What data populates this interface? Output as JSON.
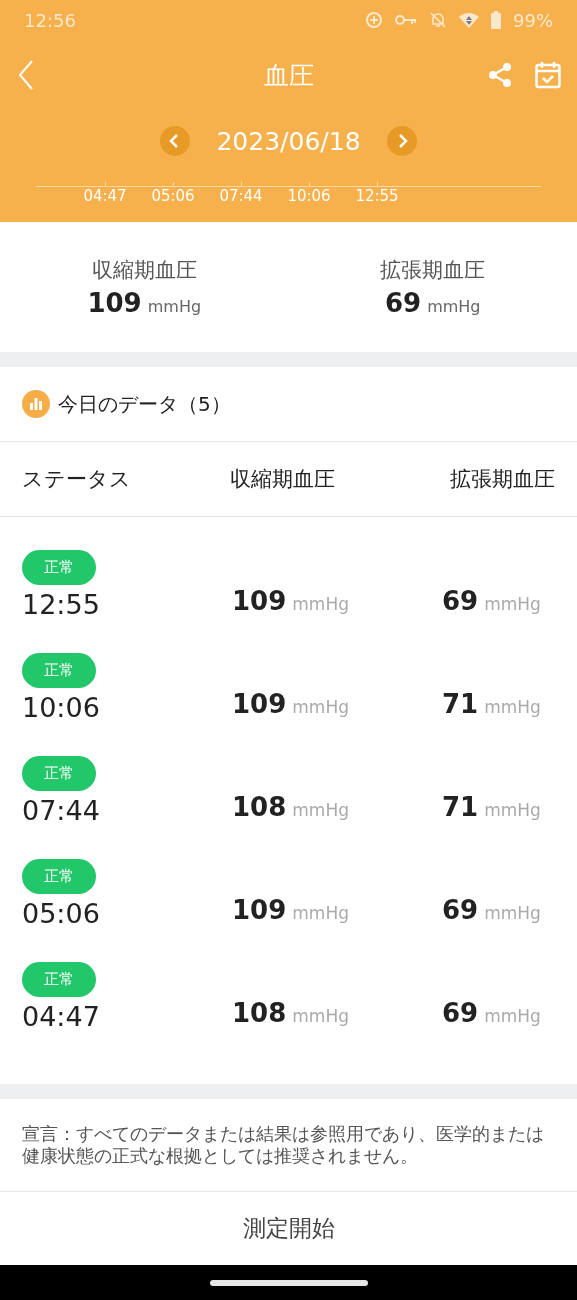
{
  "status_bar": {
    "time": "12:56",
    "battery": "99%"
  },
  "header": {
    "title": "血圧",
    "date": "2023/06/18",
    "timeline": [
      "04:47",
      "05:06",
      "07:44",
      "10:06",
      "12:55"
    ]
  },
  "summary": [
    {
      "label": "収縮期血圧",
      "value": "109",
      "unit": "mmHg"
    },
    {
      "label": "拡張期血圧",
      "value": "69",
      "unit": "mmHg"
    }
  ],
  "today": {
    "title": "今日のデータ（5）",
    "columns": [
      "ステータス",
      "収縮期血圧",
      "拡張期血圧"
    ],
    "rows": [
      {
        "status": "正常",
        "time": "12:55",
        "systolic": "109",
        "systolic_unit": "mmHg",
        "diastolic": "69",
        "diastolic_unit": "mmHg"
      },
      {
        "status": "正常",
        "time": "10:06",
        "systolic": "109",
        "systolic_unit": "mmHg",
        "diastolic": "71",
        "diastolic_unit": "mmHg"
      },
      {
        "status": "正常",
        "time": "07:44",
        "systolic": "108",
        "systolic_unit": "mmHg",
        "diastolic": "71",
        "diastolic_unit": "mmHg"
      },
      {
        "status": "正常",
        "time": "05:06",
        "systolic": "109",
        "systolic_unit": "mmHg",
        "diastolic": "69",
        "diastolic_unit": "mmHg"
      },
      {
        "status": "正常",
        "time": "04:47",
        "systolic": "108",
        "systolic_unit": "mmHg",
        "diastolic": "69",
        "diastolic_unit": "mmHg"
      }
    ]
  },
  "disclaimer": "宣言：すべてのデータまたは結果は参照用であり、医学的または健康状態の正式な根拠としては推奨されません。",
  "start_button": "測定開始"
}
